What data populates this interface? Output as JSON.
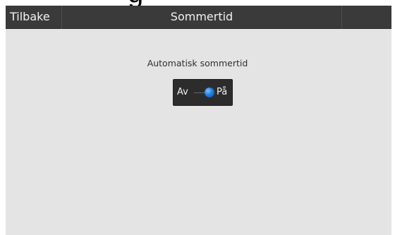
{
  "header": {
    "back_label": "Tilbake",
    "title": "Sommertid"
  },
  "setting": {
    "label": "Automatisk sommertid",
    "toggle": {
      "off_label": "Av",
      "on_label": "På",
      "state": "on",
      "accent_color": "#1f7fe0"
    }
  },
  "colors": {
    "header_bg": "#3a3a3a",
    "screen_bg": "#e4e4e4",
    "toggle_bg": "#2c2c2c"
  }
}
